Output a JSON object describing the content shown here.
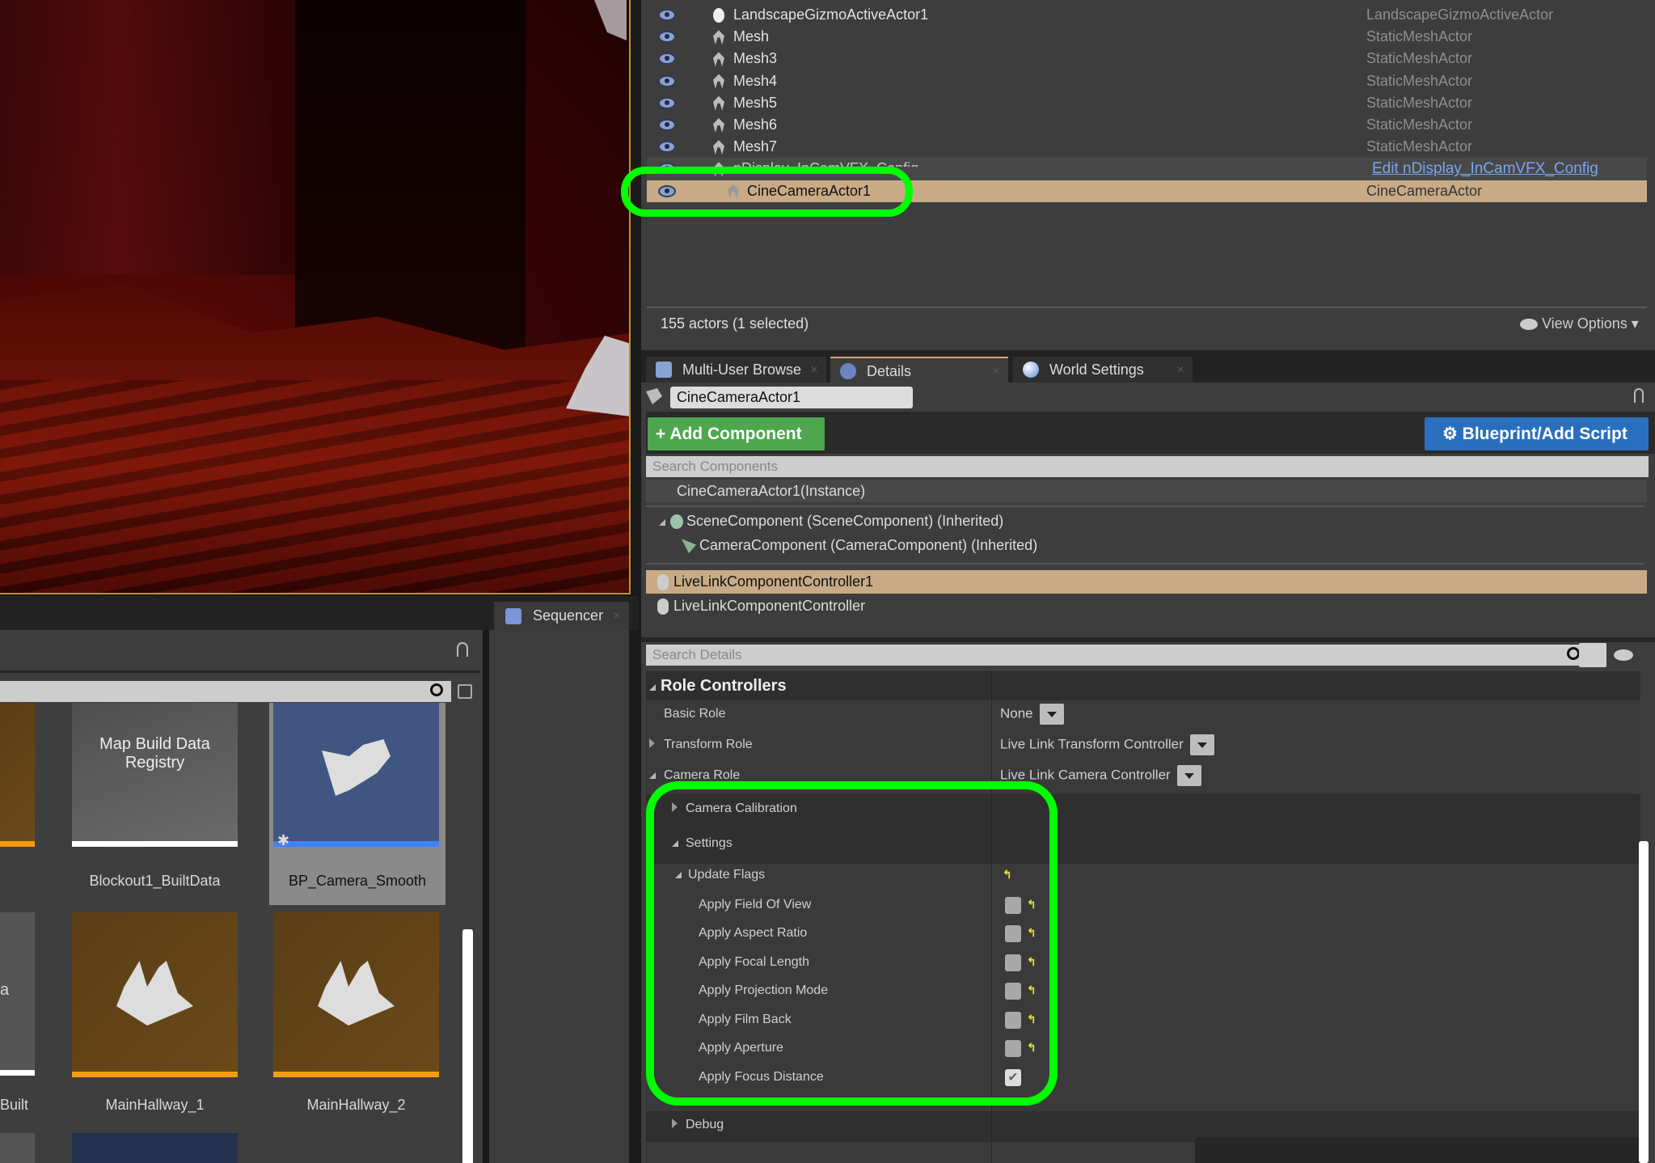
{
  "outliner": {
    "rows": [
      {
        "name": "LandscapeGizmoActiveActor1",
        "type": "LandscapeGizmoActiveActor"
      },
      {
        "name": "Mesh",
        "type": "StaticMeshActor"
      },
      {
        "name": "Mesh3",
        "type": "StaticMeshActor"
      },
      {
        "name": "Mesh4",
        "type": "StaticMeshActor"
      },
      {
        "name": "Mesh5",
        "type": "StaticMeshActor"
      },
      {
        "name": "Mesh6",
        "type": "StaticMeshActor"
      },
      {
        "name": "Mesh7",
        "type": "StaticMeshActor"
      },
      {
        "name": "nDisplay_InCamVFX_Config",
        "type": "Edit nDisplay_InCamVFX_Config"
      },
      {
        "name": "CineCameraActor1",
        "type": "CineCameraActor",
        "selected": true
      }
    ],
    "status": "155 actors (1 selected)",
    "view_options": "View Options"
  },
  "tabs": [
    {
      "label": "Multi-User Browse"
    },
    {
      "label": "Details",
      "active": true
    },
    {
      "label": "World Settings"
    }
  ],
  "details": {
    "actor_name": "CineCameraActor1",
    "add_component": "+ Add Component",
    "blueprint": "Blueprint/Add Script",
    "search_components_placeholder": "Search Components",
    "instance": "CineCameraActor1(Instance)",
    "components": [
      "SceneComponent (SceneComponent) (Inherited)",
      "CameraComponent (CameraComponent) (Inherited)",
      "LiveLinkComponentController1",
      "LiveLinkComponentController"
    ],
    "search_details_placeholder": "Search Details",
    "section": "Role Controllers",
    "basic_role": {
      "label": "Basic Role",
      "value": "None"
    },
    "transform_role": {
      "label": "Transform Role",
      "value": "Live Link Transform Controller"
    },
    "camera_role": {
      "label": "Camera Role",
      "value": "Live Link Camera Controller"
    },
    "camera_calibration": "Camera Calibration",
    "settings": "Settings",
    "update_flags": "Update Flags",
    "flags": [
      {
        "label": "Apply Field Of View",
        "checked": false
      },
      {
        "label": "Apply Aspect Ratio",
        "checked": false
      },
      {
        "label": "Apply Focal Length",
        "checked": false
      },
      {
        "label": "Apply Projection Mode",
        "checked": false
      },
      {
        "label": "Apply Film Back",
        "checked": false
      },
      {
        "label": "Apply Aperture",
        "checked": false
      },
      {
        "label": "Apply Focus Distance",
        "checked": true
      }
    ],
    "debug": "Debug"
  },
  "sequencer": {
    "tab": "Sequencer"
  },
  "content_browser": {
    "tiles": [
      {
        "thumb_text": "Map Build Data Registry",
        "label": "Blockout1_BuiltData"
      },
      {
        "label": "BP_Camera_Smooth",
        "selected": true
      },
      {
        "label": "MainHallway_1"
      },
      {
        "label": "MainHallway_2"
      },
      {
        "partial_label": "Built",
        "partial_thumb": "a"
      }
    ]
  },
  "colors": {
    "selection": "#c8ab86",
    "highlight": "#00ff00",
    "add_component": "#4ea64e",
    "blueprint": "#2a6fbd"
  }
}
